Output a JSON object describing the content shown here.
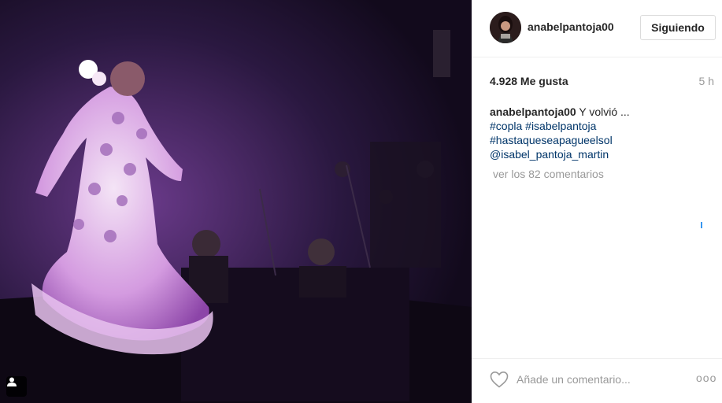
{
  "post": {
    "photo_alt": "flamenco performance photo",
    "tag_icon": "user-tag-icon"
  },
  "header": {
    "username": "anabelpantoja00",
    "follow_label": "Siguiendo"
  },
  "stats": {
    "likes": "4.928 Me gusta",
    "time": "5 h"
  },
  "caption": {
    "user": "anabelpantoja00",
    "text": "Y volvió ...",
    "tags": [
      "#copla",
      "#isabelpantoja",
      "#hastaqueseapagueelsol",
      "@isabel_pantoja_martin"
    ],
    "tag_line1": "#copla #isabelpantoja"
  },
  "comments": {
    "view_all": "ver los 82 comentarios"
  },
  "footer": {
    "placeholder": "Añade un comentario...",
    "more_label": "ooo"
  },
  "colors": {
    "tag_link": "#003569",
    "muted": "#999999",
    "border": "#efefef",
    "accent": "#3897f0"
  }
}
